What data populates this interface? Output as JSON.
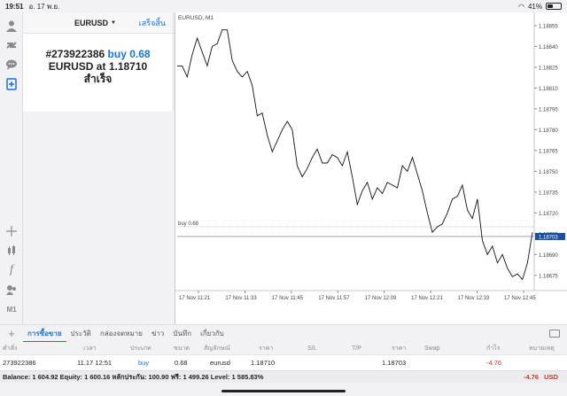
{
  "status": {
    "time": "19:51",
    "date": "อ. 17 พ.ย.",
    "battery": "41%",
    "battery_level": 0.41
  },
  "order_panel": {
    "symbol": "EURUSD",
    "done_label": "เสร็จสิ้น",
    "ticket": "#273922386",
    "action": "buy 0.68",
    "line2_symbol": "EURUSD at",
    "line2_price": "1.18710",
    "result": "สำเร็จ"
  },
  "chart_header": "EURUSD, M1",
  "buy_line_label": "buy 0.68",
  "current_price_label": "1.18703",
  "chart_data": {
    "type": "line",
    "title": "",
    "xlabel": "",
    "ylabel": "",
    "y_ticks": [
      "1.18855",
      "1.18840",
      "1.18825",
      "1.18810",
      "1.18795",
      "1.18780",
      "1.18765",
      "1.18750",
      "1.18735",
      "1.18720",
      "1.18705",
      "1.18690",
      "1.18675"
    ],
    "x_ticks": [
      "17 Nov 11:21",
      "17 Nov 11:33",
      "17 Nov 11:45",
      "17 Nov 11:57",
      "17 Nov 12:09",
      "17 Nov 12:21",
      "17 Nov 12:33",
      "17 Nov 12:45"
    ],
    "ylim": [
      1.18664,
      1.18862
    ],
    "buy_level": 1.1871,
    "current_price": 1.18703,
    "series": [
      {
        "values": [
          1.18826,
          1.18826,
          1.18818,
          1.18834,
          1.18846,
          1.18836,
          1.18826,
          1.1884,
          1.18842,
          1.18852,
          1.18852,
          1.1883,
          1.18822,
          1.18818,
          1.18822,
          1.18812,
          1.1879,
          1.18792,
          1.18776,
          1.18764,
          1.18772,
          1.1878,
          1.18786,
          1.1878,
          1.18754,
          1.18746,
          1.18752,
          1.1876,
          1.18766,
          1.18756,
          1.18756,
          1.18762,
          1.1876,
          1.18754,
          1.18764,
          1.18746,
          1.18726,
          1.18736,
          1.18742,
          1.1873,
          1.18738,
          1.18734,
          1.18742,
          1.1874,
          1.18738,
          1.18754,
          1.1875,
          1.1876,
          1.18748,
          1.18736,
          1.1872,
          1.18706,
          1.1871,
          1.18712,
          1.1872,
          1.1873,
          1.18732,
          1.1874,
          1.18722,
          1.18716,
          1.1873,
          1.187,
          1.1869,
          1.18696,
          1.18684,
          1.1869,
          1.1868,
          1.18674,
          1.18676,
          1.18672,
          1.18684,
          1.18706
        ]
      }
    ]
  },
  "tabs": [
    {
      "label": "การซื้อขาย",
      "active": true
    },
    {
      "label": "ประวัติ",
      "active": false
    },
    {
      "label": "กล่องจดหมาย",
      "active": false
    },
    {
      "label": "ข่าว",
      "active": false
    },
    {
      "label": "บันทึก",
      "active": false
    },
    {
      "label": "เกี่ยวกับ",
      "active": false
    }
  ],
  "table": {
    "headers": {
      "order": "คำสั่ง",
      "time": "เวลา",
      "type": "ประเภท",
      "size": "ขนาด",
      "symbol": "สัญลักษณ์",
      "price": "ราคา",
      "sl": "S/L",
      "tp": "T/P",
      "price2": "ราคา",
      "swap": "Swap",
      "profit": "กำไร",
      "comment": "หมายเหตุ"
    },
    "row": {
      "order": "273922386",
      "time": "11.17 12:51",
      "type": "buy",
      "size": "0.68",
      "symbol": "eurusd",
      "price": "1.18710",
      "price2": "1.18703",
      "profit": "-4.76"
    }
  },
  "balance_line": "Balance: 1 604.92 Equity: 1 600.16 หลักประกัน: 100.90 ฟรี: 1 499.26 Level: 1 585.83%",
  "total_profit": "-4.76",
  "currency": "USD",
  "colors": {
    "accent": "#1a73d9",
    "loss": "#d0312d"
  }
}
